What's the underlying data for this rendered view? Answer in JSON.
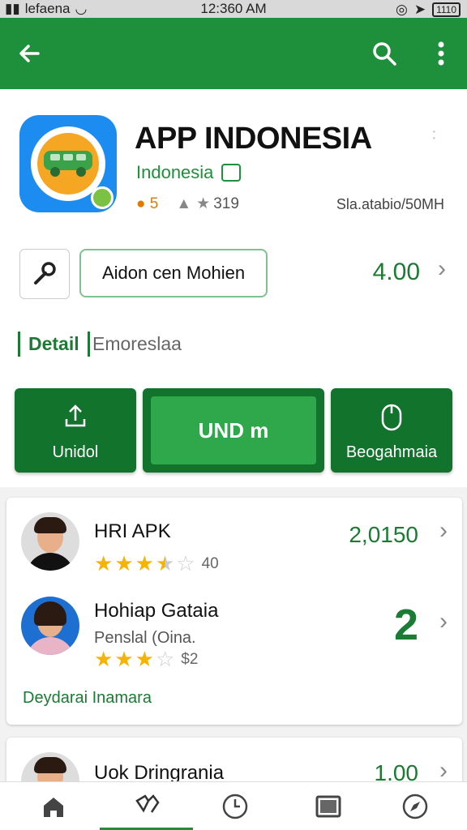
{
  "status_bar": {
    "carrier": "lefaena",
    "time": "12:360 AM",
    "battery": "1110"
  },
  "app_bar": {
    "back_icon": "back-arrow-icon",
    "search_icon": "search-icon",
    "menu_icon": "more-vert-icon",
    "color": "#1e8f3a"
  },
  "app": {
    "title": "APP INDONESIA",
    "developer": "Indonesia",
    "rating": "5",
    "reviews": "319",
    "size": "Sla.atabio/50MH"
  },
  "tools": {
    "chip_label": "Aidon cen Mohien",
    "price": "4.00"
  },
  "detail": {
    "tab": "Detail",
    "subtitle": "Emoreslaa"
  },
  "actions": {
    "left_label": "Unidol",
    "middle_label": "UND m",
    "right_label": "Beogahmaia"
  },
  "list": {
    "items": [
      {
        "title": "HRI APK",
        "rating_value": 3.5,
        "count": "40",
        "price": "2,0150"
      },
      {
        "title": "Hohiap Gataia",
        "subtitle": "Penslal (Oina.",
        "rating_value": 3,
        "count": "$2",
        "price": "2"
      }
    ],
    "link": "Deydarai Inamara"
  },
  "list2": {
    "items": [
      {
        "title": "Uok Dringrania",
        "price": "1.00"
      }
    ]
  },
  "bottom_nav": [
    {
      "name": "home-icon"
    },
    {
      "name": "apps-icon",
      "active": true
    },
    {
      "name": "clock-icon"
    },
    {
      "name": "screen-icon"
    },
    {
      "name": "compass-icon"
    }
  ]
}
